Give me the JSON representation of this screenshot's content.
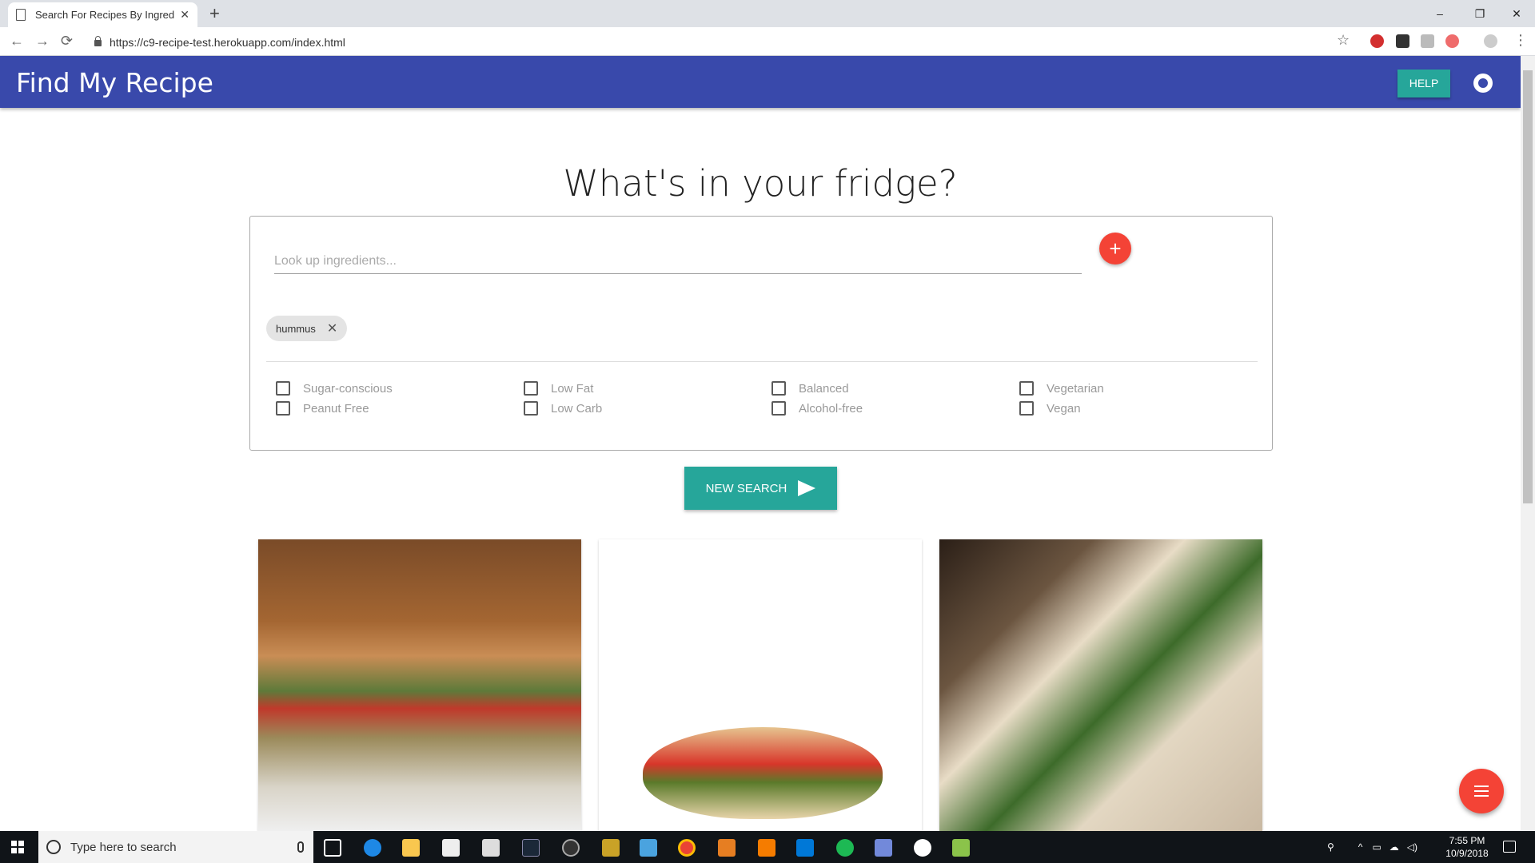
{
  "browser": {
    "tab_title": "Search For Recipes By Ingredient",
    "tab_close": "✕",
    "new_tab": "+",
    "url": "https://c9-recipe-test.herokuapp.com/index.html",
    "win_minimize": "–",
    "win_restore": "❐",
    "win_close": "✕",
    "back": "←",
    "forward": "→",
    "reload": "⟳",
    "bookmark": "☆",
    "menu": "⋮"
  },
  "app": {
    "brand": "Find My Recipe",
    "help_label": "HELP"
  },
  "main": {
    "heading": "What's in your fridge?",
    "search_placeholder": "Look up ingredients...",
    "add_label": "+",
    "chips": [
      {
        "label": "hummus",
        "remove": "✕"
      }
    ],
    "filters": [
      {
        "label": "Sugar-conscious",
        "checked": false
      },
      {
        "label": "Low Fat",
        "checked": false
      },
      {
        "label": "Balanced",
        "checked": false
      },
      {
        "label": "Vegetarian",
        "checked": false
      },
      {
        "label": "Peanut Free",
        "checked": false
      },
      {
        "label": "Low Carb",
        "checked": false
      },
      {
        "label": "Alcohol-free",
        "checked": false
      },
      {
        "label": "Vegan",
        "checked": false
      }
    ],
    "search_button": "NEW SEARCH"
  },
  "cards": [
    {
      "image": "veggie-burger-photo"
    },
    {
      "image": "pita-sandwich-photo"
    },
    {
      "image": "wrap-photo"
    }
  ],
  "taskbar": {
    "search_placeholder": "Type here to search",
    "time": "7:55 PM",
    "date": "10/9/2018"
  },
  "colors": {
    "primary": "#3949ab",
    "accent": "#26a69a",
    "fab": "#f44336"
  }
}
